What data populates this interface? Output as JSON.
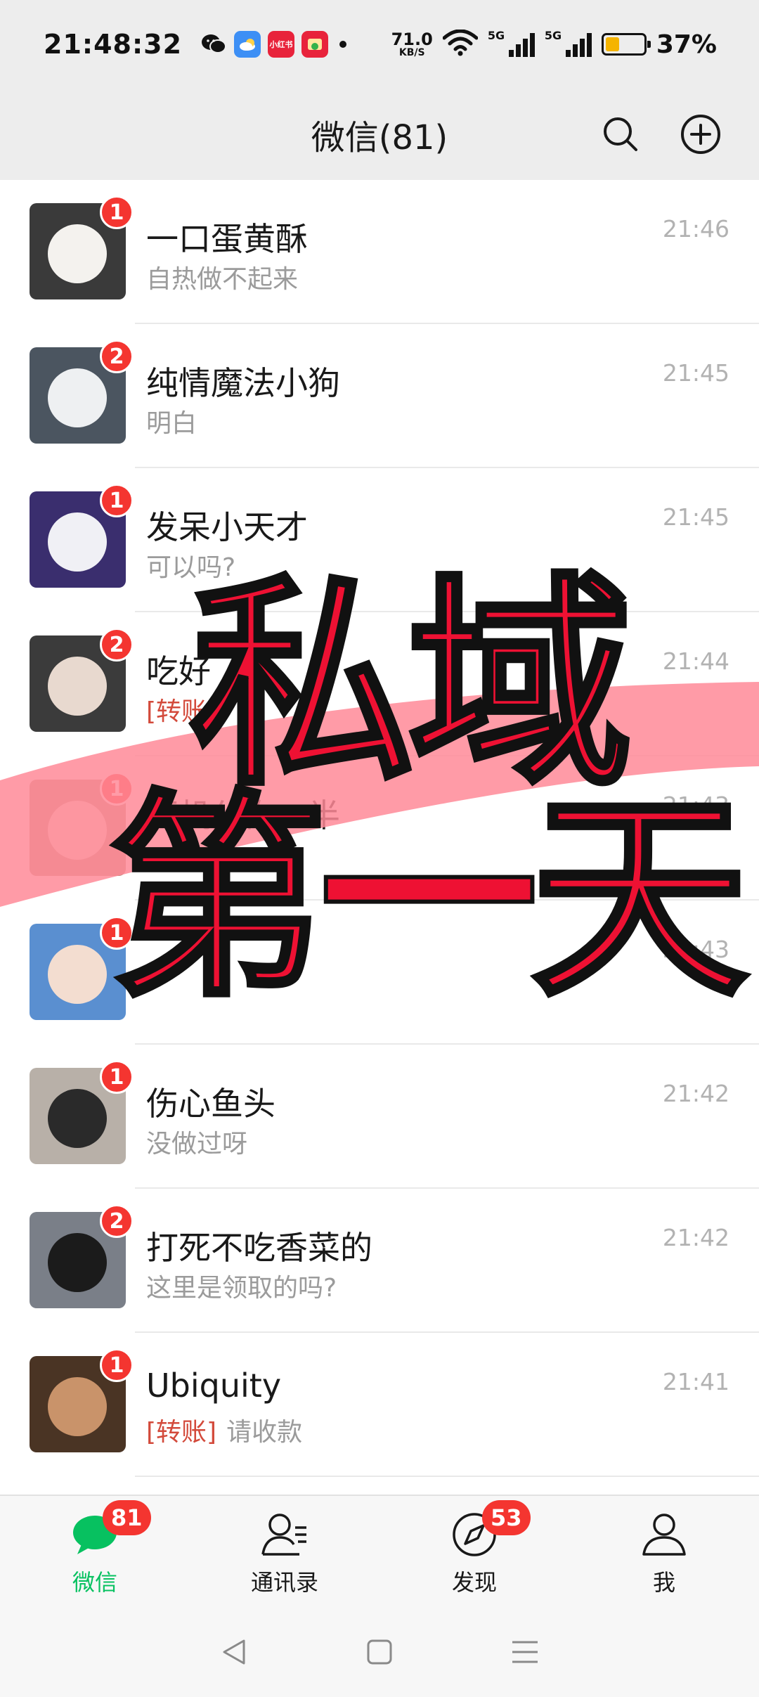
{
  "status_bar": {
    "time": "21:48:32",
    "apps": [
      {
        "icon": "wechat-icon",
        "label": "",
        "color": "#111111"
      },
      {
        "icon": "weather-icon",
        "label": "",
        "color": "#3d8ff5"
      },
      {
        "icon": "xiaohongshu-icon",
        "label": "小红书",
        "color": "#e8233b"
      },
      {
        "icon": "shop-icon",
        "label": "",
        "color": "#e8233b"
      }
    ],
    "net_speed_value": "71.0",
    "net_speed_unit": "KB/S",
    "signal_1_label": "5G",
    "signal_2_label": "5G",
    "battery_percent": "37%",
    "battery_level": 0.37,
    "battery_color": "#f5b400"
  },
  "header": {
    "title": "微信(81)",
    "search_icon": "search-icon",
    "add_icon": "plus-circle-icon"
  },
  "chats": [
    {
      "name": "一口蛋黄酥",
      "preview": "自热做不起来",
      "preview_tag": "",
      "time": "21:46",
      "badge": "1",
      "avatar_bg": "#3a3a3a",
      "avatar_face": "#f4f2ee"
    },
    {
      "name": "纯情魔法小狗",
      "preview": "明白",
      "preview_tag": "",
      "time": "21:45",
      "badge": "2",
      "avatar_bg": "#4b5560",
      "avatar_face": "#eef0f2"
    },
    {
      "name": "发呆小天才",
      "preview": "可以吗?",
      "preview_tag": "",
      "time": "21:45",
      "badge": "1",
      "avatar_bg": "#3a2e6e",
      "avatar_face": "#f0f0f5"
    },
    {
      "name": "吃好",
      "preview": "",
      "preview_tag": "[转账]",
      "time": "21:44",
      "badge": "2",
      "avatar_bg": "#3b3b3b",
      "avatar_face": "#e8d9cf"
    },
    {
      "name": "耳机分你一半",
      "preview": "",
      "preview_tag": "",
      "time": "21:43",
      "badge": "1",
      "avatar_bg": "#b88a7a",
      "avatar_face": "#f2ddd0"
    },
    {
      "name": "",
      "preview": "",
      "preview_tag": "",
      "time": "21:43",
      "badge": "1",
      "avatar_bg": "#5a8fd0",
      "avatar_face": "#f3ddd0"
    },
    {
      "name": "伤心鱼头",
      "preview": "没做过呀",
      "preview_tag": "",
      "time": "21:42",
      "badge": "1",
      "avatar_bg": "#b8b0a8",
      "avatar_face": "#2a2a2a"
    },
    {
      "name": "打死不吃香菜的",
      "preview": "这里是领取的吗?",
      "preview_tag": "",
      "time": "21:42",
      "badge": "2",
      "avatar_bg": "#7a7f88",
      "avatar_face": "#1b1b1b"
    },
    {
      "name": "Ubiquity",
      "preview": "请收款",
      "preview_tag": "[转账]",
      "time": "21:41",
      "badge": "1",
      "avatar_bg": "#4a3424",
      "avatar_face": "#c9936a"
    }
  ],
  "overlay": {
    "line1": "私域",
    "line2": "第一天",
    "text_color": "#ee1133",
    "brush_color": "#ff8a98"
  },
  "tab_bar": {
    "tabs": [
      {
        "label": "微信",
        "icon": "chat-bubble-icon",
        "badge": "81",
        "active": true
      },
      {
        "label": "通讯录",
        "icon": "contacts-icon",
        "badge": "",
        "active": false
      },
      {
        "label": "发现",
        "icon": "compass-icon",
        "badge": "53",
        "active": false
      },
      {
        "label": "我",
        "icon": "person-icon",
        "badge": "",
        "active": false
      }
    ],
    "active_color": "#07c160"
  },
  "system_nav": {
    "back_icon": "back-triangle-icon",
    "home_icon": "home-square-icon",
    "menu_icon": "menu-lines-icon"
  }
}
